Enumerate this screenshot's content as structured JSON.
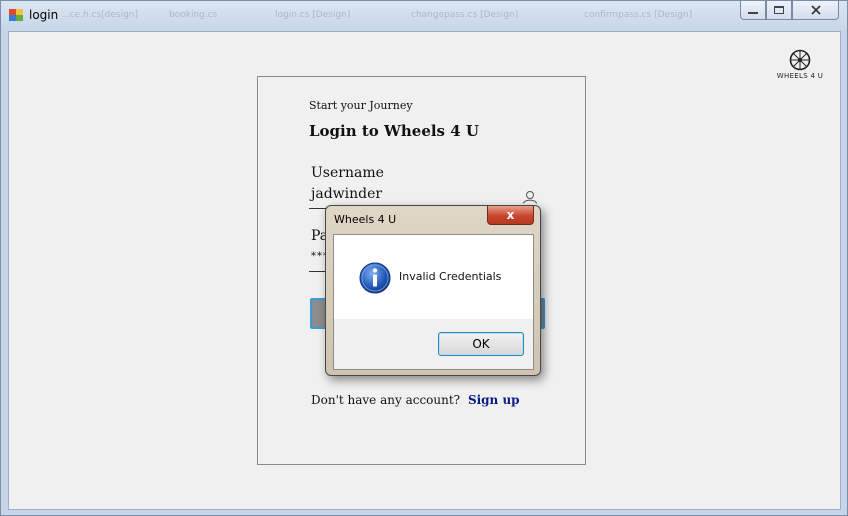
{
  "window": {
    "title": "login",
    "background_tabs": [
      "...ce.h.cs[design]",
      "booking.cs",
      "login.cs [Design]",
      "changepass.cs [Design]",
      "confirmpass.cs [Design]"
    ]
  },
  "brand": {
    "name": "WHEELS 4 U"
  },
  "login": {
    "eyebrow": "Start your Journey",
    "heading": "Login to Wheels 4 U",
    "username_label": "Username",
    "username_value": "jadwinder",
    "password_label": "Password",
    "password_value": "**********",
    "signup_prompt": "Don't have any account?",
    "signup_link": "Sign up"
  },
  "dialog": {
    "title": "Wheels 4 U",
    "close_label": "x",
    "message": "Invalid Credentials",
    "ok_label": "OK",
    "icon": "info-icon"
  },
  "colors": {
    "button_border": "#3d9bd6",
    "signup_link": "#0a1a86",
    "close_button": "#c9452c"
  }
}
